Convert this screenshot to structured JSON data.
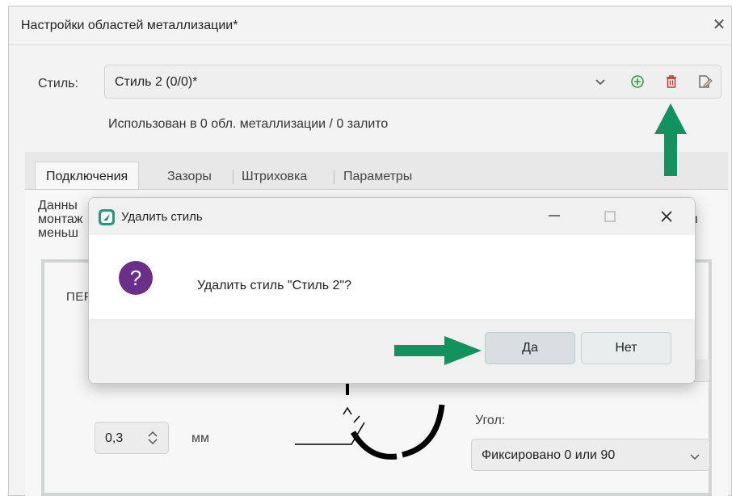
{
  "window": {
    "title": "Настройки областей металлизации*",
    "close_icon": "close-icon"
  },
  "style": {
    "label": "Стиль:",
    "selected": "Стиль 2 (0/0)*",
    "usage_info": "Использован в 0 обл. металлизации / 0 залито",
    "icons": [
      "chevron-down-icon",
      "add-circle-icon",
      "trash-icon",
      "edit-icon"
    ],
    "add_color": "#2e9e3e",
    "delete_color": "#c0392b"
  },
  "tabs": [
    {
      "label": "Подключения",
      "active": true
    },
    {
      "label": "Зазоры",
      "active": false
    },
    {
      "label": "Штриховка",
      "active": false
    },
    {
      "label": "Параметры",
      "active": false
    }
  ],
  "panel": {
    "desc_line1": "Данны",
    "desc_line2": "монтаж",
    "desc_line3": "меньш",
    "desc_tail": "я",
    "group_title": "ПЕР",
    "spin_value": "0,3",
    "unit": "мм",
    "angle_label": "Угол:",
    "angle_value": "Фиксировано 0 или 90"
  },
  "dialog": {
    "title": "Удалить стиль",
    "message": "Удалить стиль \"Стиль 2\"?",
    "yes_label": "Да",
    "no_label": "Нет",
    "question_icon": "question-icon",
    "question_color": "#6b2f8a"
  },
  "annotations": {
    "arrow_color": "#12925f"
  }
}
